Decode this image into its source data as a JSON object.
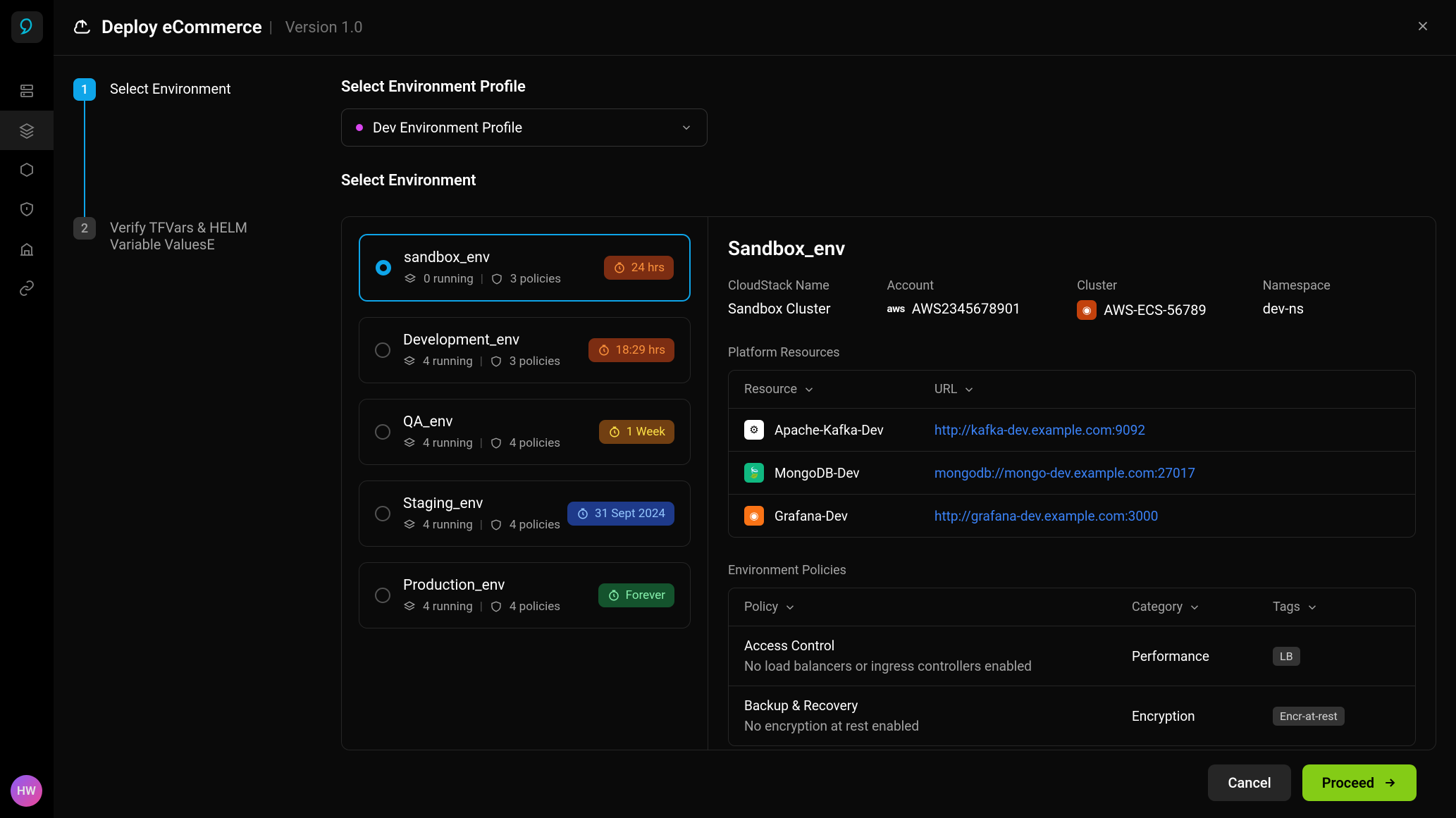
{
  "header": {
    "title": "Deploy eCommerce",
    "version": "Version 1.0"
  },
  "avatar": "HW",
  "steps": [
    {
      "num": "1",
      "label": "Select Environment",
      "active": true
    },
    {
      "num": "2",
      "label": "Verify TFVars & HELM  Variable ValuesE",
      "active": false
    }
  ],
  "profile_section_title": "Select Environment Profile",
  "profile_selected": "Dev Environment Profile",
  "env_section_title": "Select Environment",
  "environments": [
    {
      "name": "sandbox_env",
      "running": "0 running",
      "policies": "3 policies",
      "badge": "24 hrs",
      "badge_style": "orange",
      "selected": true
    },
    {
      "name": "Development_env",
      "running": "4 running",
      "policies": "3 policies",
      "badge": "18:29 hrs",
      "badge_style": "orange",
      "selected": false
    },
    {
      "name": "QA_env",
      "running": "4 running",
      "policies": "4 policies",
      "badge": "1 Week",
      "badge_style": "yellow",
      "selected": false
    },
    {
      "name": "Staging_env",
      "running": "4 running",
      "policies": "4 policies",
      "badge": "31 Sept 2024",
      "badge_style": "blue",
      "selected": false
    },
    {
      "name": "Production_env",
      "running": "4 running",
      "policies": "4 policies",
      "badge": "Forever",
      "badge_style": "green",
      "selected": false
    }
  ],
  "detail": {
    "title": "Sandbox_env",
    "meta": {
      "cloudstack_label": "CloudStack Name",
      "cloudstack_value": "Sandbox Cluster",
      "account_label": "Account",
      "account_value": "AWS2345678901",
      "cluster_label": "Cluster",
      "cluster_value": "AWS-ECS-56789",
      "namespace_label": "Namespace",
      "namespace_value": "dev-ns"
    },
    "resources_title": "Platform Resources",
    "resources_headers": {
      "col1": "Resource",
      "col2": "URL"
    },
    "resources": [
      {
        "name": "Apache-Kafka-Dev",
        "url": "http://kafka-dev.example.com:9092",
        "icon": "white",
        "glyph": "⚙"
      },
      {
        "name": "MongoDB-Dev",
        "url": "mongodb://mongo-dev.example.com:27017",
        "icon": "green",
        "glyph": "🍃"
      },
      {
        "name": "Grafana-Dev",
        "url": "http://grafana-dev.example.com:3000",
        "icon": "orange",
        "glyph": "◉"
      }
    ],
    "policies_title": "Environment Policies",
    "policies_headers": {
      "col1": "Policy",
      "col2": "Category",
      "col3": "Tags"
    },
    "policies": [
      {
        "name": "Access Control",
        "desc": "No load balancers or ingress controllers enabled",
        "category": "Performance",
        "tag": "LB"
      },
      {
        "name": "Backup & Recovery",
        "desc": "No encryption at rest enabled",
        "category": "Encryption",
        "tag": "Encr-at-rest"
      }
    ]
  },
  "footer": {
    "cancel": "Cancel",
    "proceed": "Proceed"
  }
}
